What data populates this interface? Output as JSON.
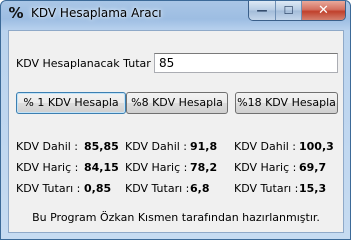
{
  "window": {
    "title": "KDV Hesaplama Aracı",
    "icon": "percent-icon",
    "minimize_glyph": "—",
    "maximize_glyph": "☐",
    "close_glyph": "✕"
  },
  "form": {
    "amount_label": "KDV Hesaplanacak Tutar :",
    "amount_value": "85"
  },
  "buttons": {
    "rate1": "% 1 KDV Hesapla",
    "rate8": "%8 KDV Hesapla",
    "rate18": "%18 KDV Hesapla"
  },
  "results": {
    "label_dahil": "KDV Dahil :",
    "label_haric": "KDV Hariç :",
    "label_tutari": "KDV Tutarı :",
    "col1": {
      "dahil": "85,85",
      "haric": "84,15",
      "tutari": "0,85"
    },
    "col2": {
      "dahil": "91,8",
      "haric": "78,2",
      "tutari": "6,8"
    },
    "col3": {
      "dahil": "100,3",
      "haric": "69,7",
      "tutari": "15,3"
    }
  },
  "footer": "Bu Program Özkan Kısmen tarafından hazırlanmıştır."
}
